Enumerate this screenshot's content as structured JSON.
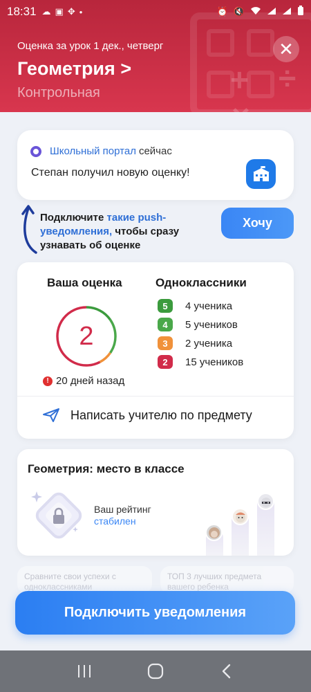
{
  "status_bar": {
    "time": "18:31",
    "left_icons": [
      "cloud-icon",
      "image-icon",
      "app-icon",
      "dot-icon"
    ],
    "right_icons": [
      "alarm-icon",
      "mute-icon",
      "wifi-icon",
      "signal-icon",
      "signal-icon",
      "battery-icon"
    ]
  },
  "header": {
    "subtitle": "Оценка за урок 1 дек., четверг",
    "title": "Геометрия",
    "title_arrow": ">",
    "kind": "Контрольная",
    "close_icon": "close-icon",
    "color": "#c92b44"
  },
  "notification": {
    "app": "Школьный портал",
    "time": "сейчас",
    "text": "Степан получил новую оценку!",
    "icon": "school-icon"
  },
  "push_prompt": {
    "text_before": "Подключите ",
    "text_highlight": "такие push-уведомления,",
    "text_after": " чтобы сразу узнавать об оценке",
    "button": "Хочу"
  },
  "grade_card": {
    "your_grade_label": "Ваша оценка",
    "grade": "2",
    "ago": "20 дней назад",
    "classmates_label": "Одноклассники",
    "distribution": [
      {
        "grade": "5",
        "text": "4 ученика",
        "color": "#3b9b3d",
        "count": 4
      },
      {
        "grade": "4",
        "text": "5 учеников",
        "color": "#4aa84a",
        "count": 5
      },
      {
        "grade": "3",
        "text": "2 ученика",
        "color": "#f0913a",
        "count": 2
      },
      {
        "grade": "2",
        "text": "15 учеников",
        "color": "#d12b4a",
        "count": 15
      }
    ],
    "write_teacher": "Написать учителю по предмету"
  },
  "rank_card": {
    "title": "Геометрия: место в классе",
    "rating_label": "Ваш рейтинг",
    "rating_status": "стабилен"
  },
  "ghost_cards": [
    {
      "text": "Сравните свои успехи с одноклассниками"
    },
    {
      "text": "ТОП 3 лучших предмета вашего ребенка"
    }
  ],
  "cta": {
    "label": "Подключить уведомления"
  },
  "nav_bar": {
    "icons": [
      "recent-apps-icon",
      "home-icon",
      "back-icon"
    ]
  }
}
